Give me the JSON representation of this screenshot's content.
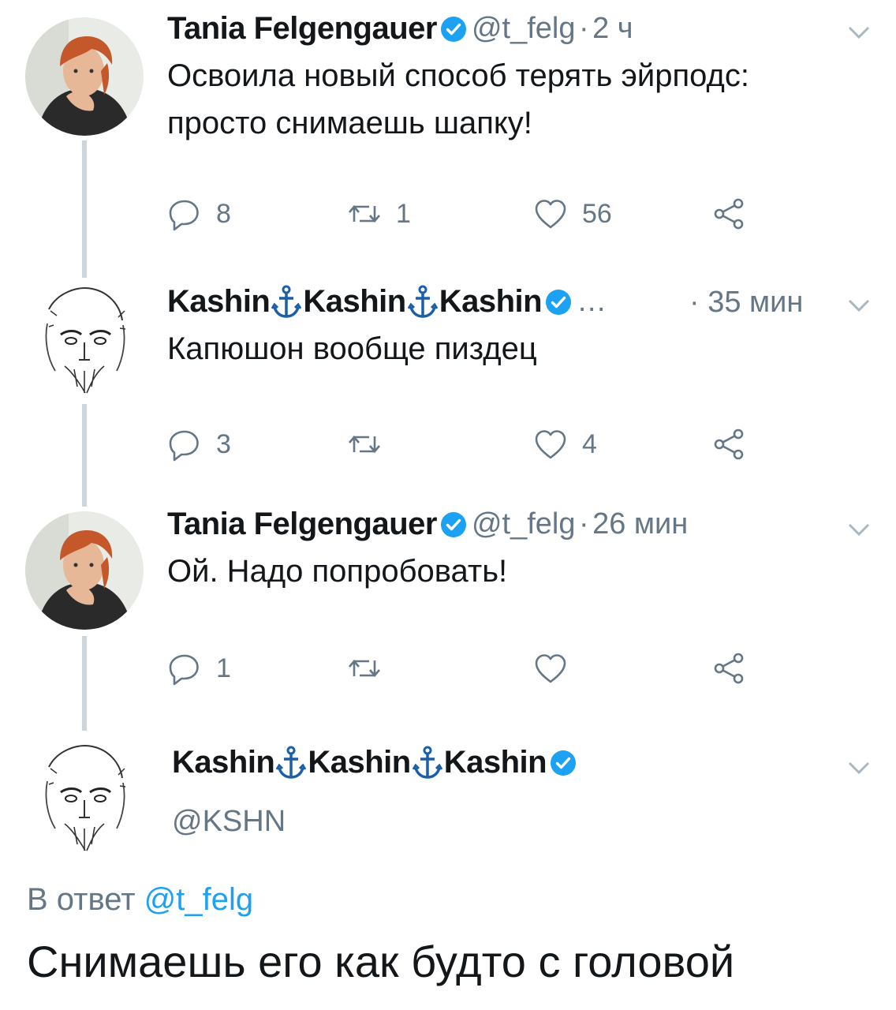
{
  "tweets": [
    {
      "name": "Tania Felgengauer",
      "handle": "@t_felg",
      "sep": "·",
      "time": "2 ч",
      "text_line1": "Освоила новый способ терять эйрподс:",
      "text_line2": "просто снимаешь шапку!",
      "replies": "8",
      "retweets": "1",
      "likes": "56"
    },
    {
      "name_part": "Kashin",
      "dots": "…",
      "time": "· 35 мин",
      "text": "Капюшон вообще пиздец",
      "replies": "3",
      "likes": "4"
    },
    {
      "name": "Tania Felgengauer",
      "handle": "@t_felg",
      "sep": "·",
      "time": "26 мин",
      "text": "Ой. Надо попробовать!",
      "replies": "1"
    }
  ],
  "main_tweet": {
    "name_part": "Kashin",
    "handle": "@KSHN",
    "reply_prefix": "В ответ",
    "reply_handle": "@t_felg",
    "text": "Снимаешь его как будто с головой"
  },
  "colors": {
    "accent": "#1da1f2",
    "muted": "#657786",
    "line": "#cdd6dd"
  },
  "icons": [
    "reply-icon",
    "retweet-icon",
    "like-icon",
    "share-icon",
    "verified-badge-icon",
    "chevron-down-icon",
    "anchor-icon"
  ]
}
